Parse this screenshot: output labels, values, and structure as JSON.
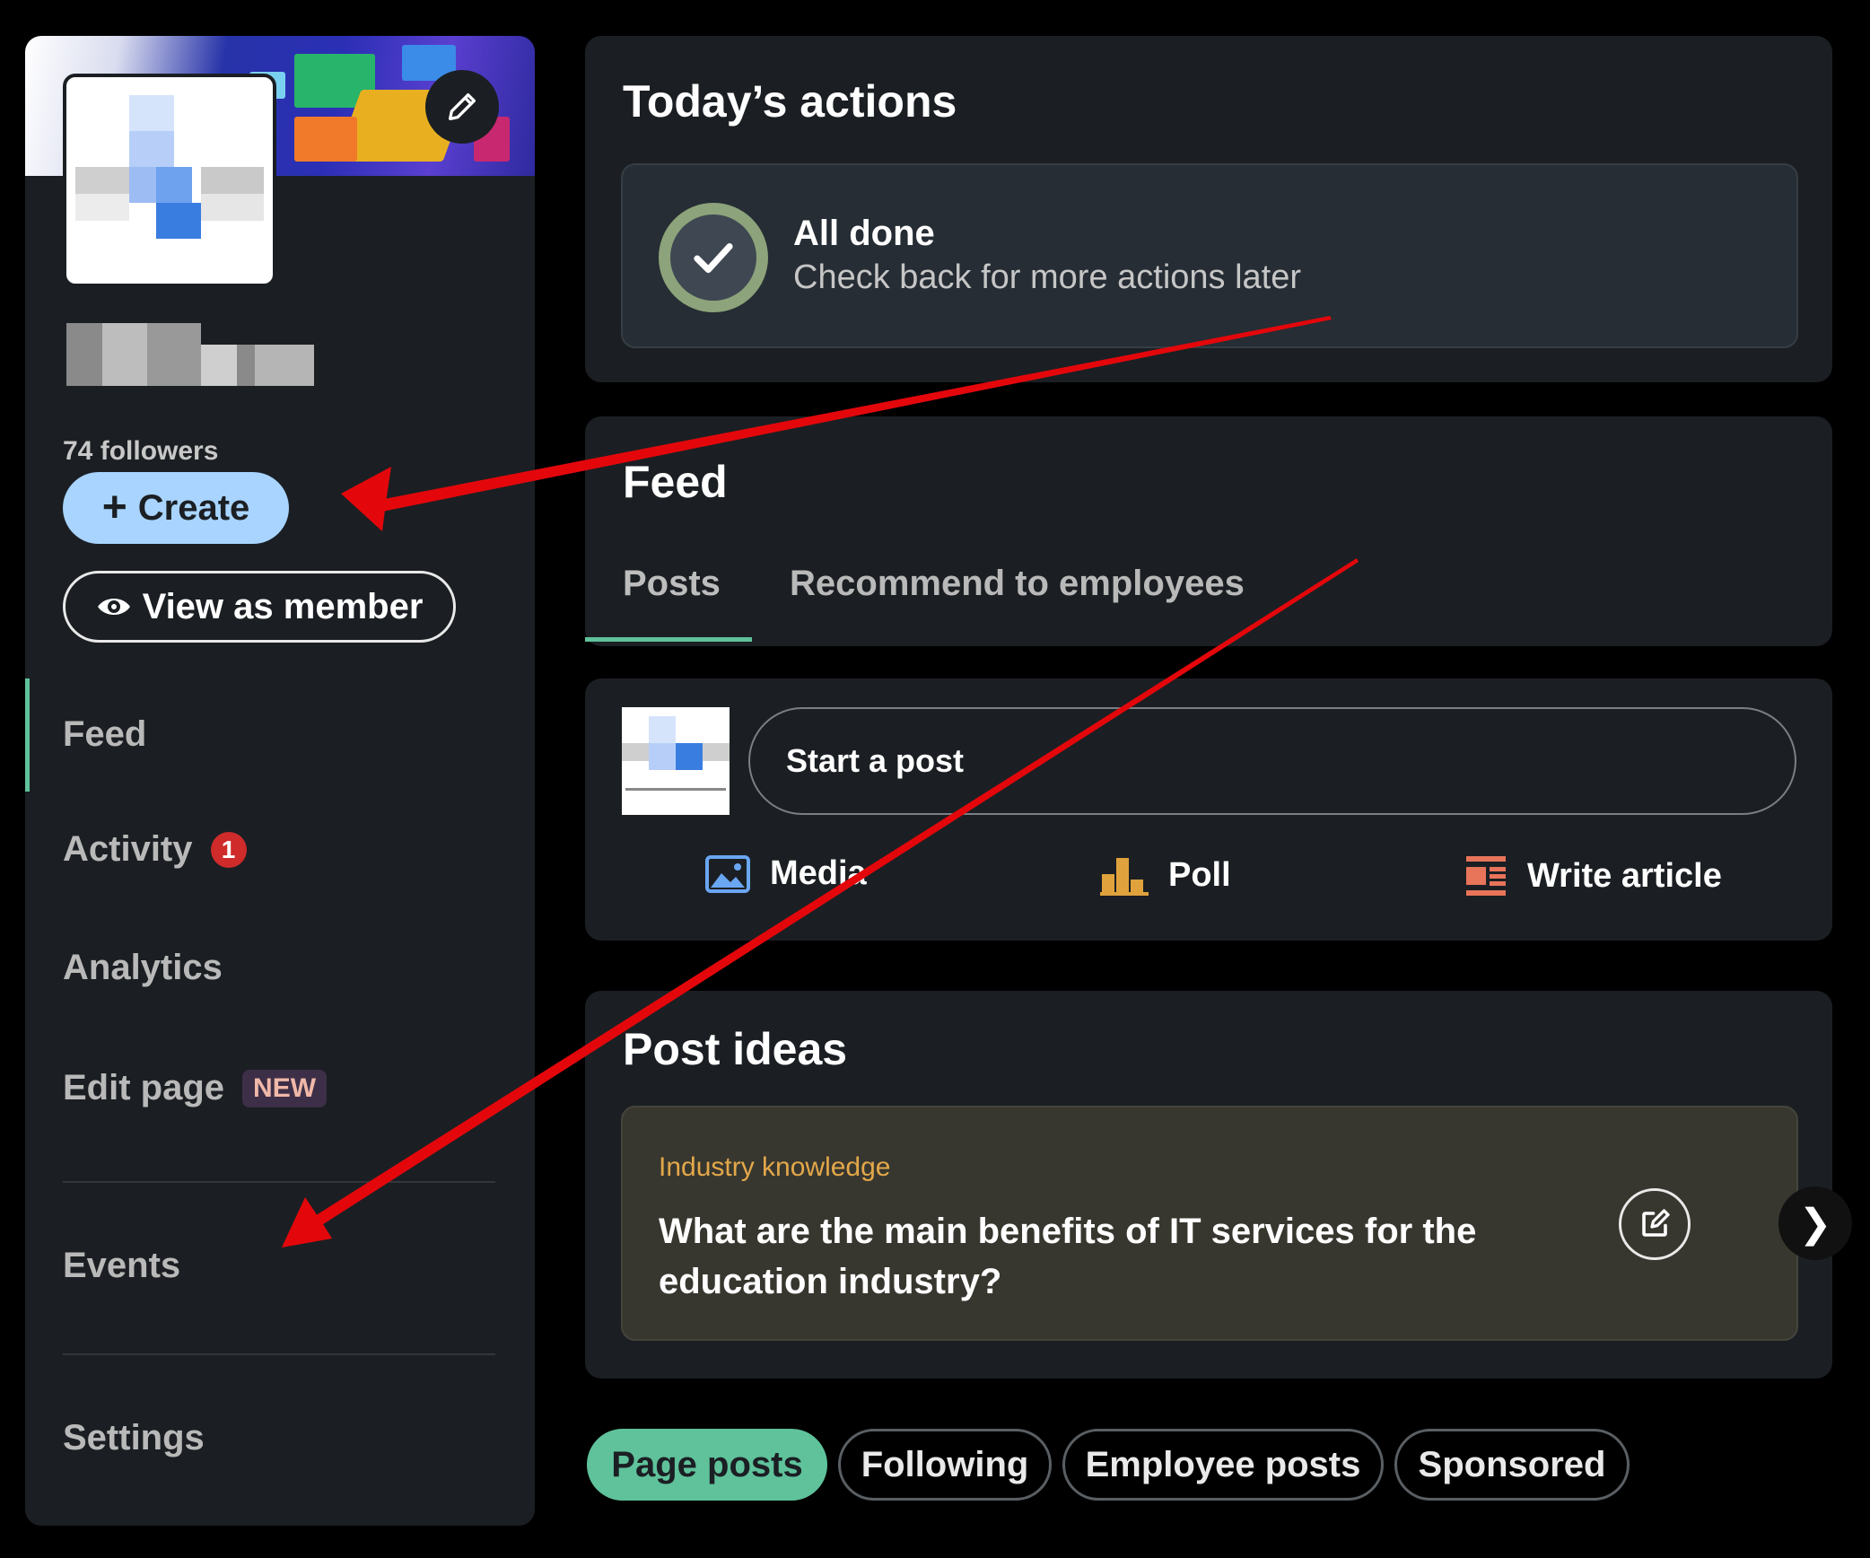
{
  "sidebar": {
    "followers": "74 followers",
    "create_label": "Create",
    "view_as_member_label": "View as member",
    "nav": {
      "feed": "Feed",
      "activity": "Activity",
      "activity_badge": "1",
      "analytics": "Analytics",
      "edit_page": "Edit page",
      "edit_page_badge": "NEW",
      "events": "Events",
      "settings": "Settings"
    }
  },
  "actions": {
    "title": "Today’s actions",
    "done_title": "All done",
    "done_subtitle": "Check back for more actions later"
  },
  "feed": {
    "title": "Feed",
    "tabs": [
      "Posts",
      "Recommend to employees"
    ]
  },
  "compose": {
    "placeholder": "Start a post",
    "media": "Media",
    "poll": "Poll",
    "article": "Write article"
  },
  "post_ideas": {
    "title": "Post ideas",
    "category": "Industry knowledge",
    "question": "What are the main benefits of IT services for the education industry?"
  },
  "filters": [
    "Page posts",
    "Following",
    "Employee posts",
    "Sponsored"
  ],
  "colors": {
    "accent_green": "#5fc29b",
    "create_blue": "#a8d4ff",
    "badge_red": "#cf2b2b",
    "annotation_red": "#e3070b"
  }
}
